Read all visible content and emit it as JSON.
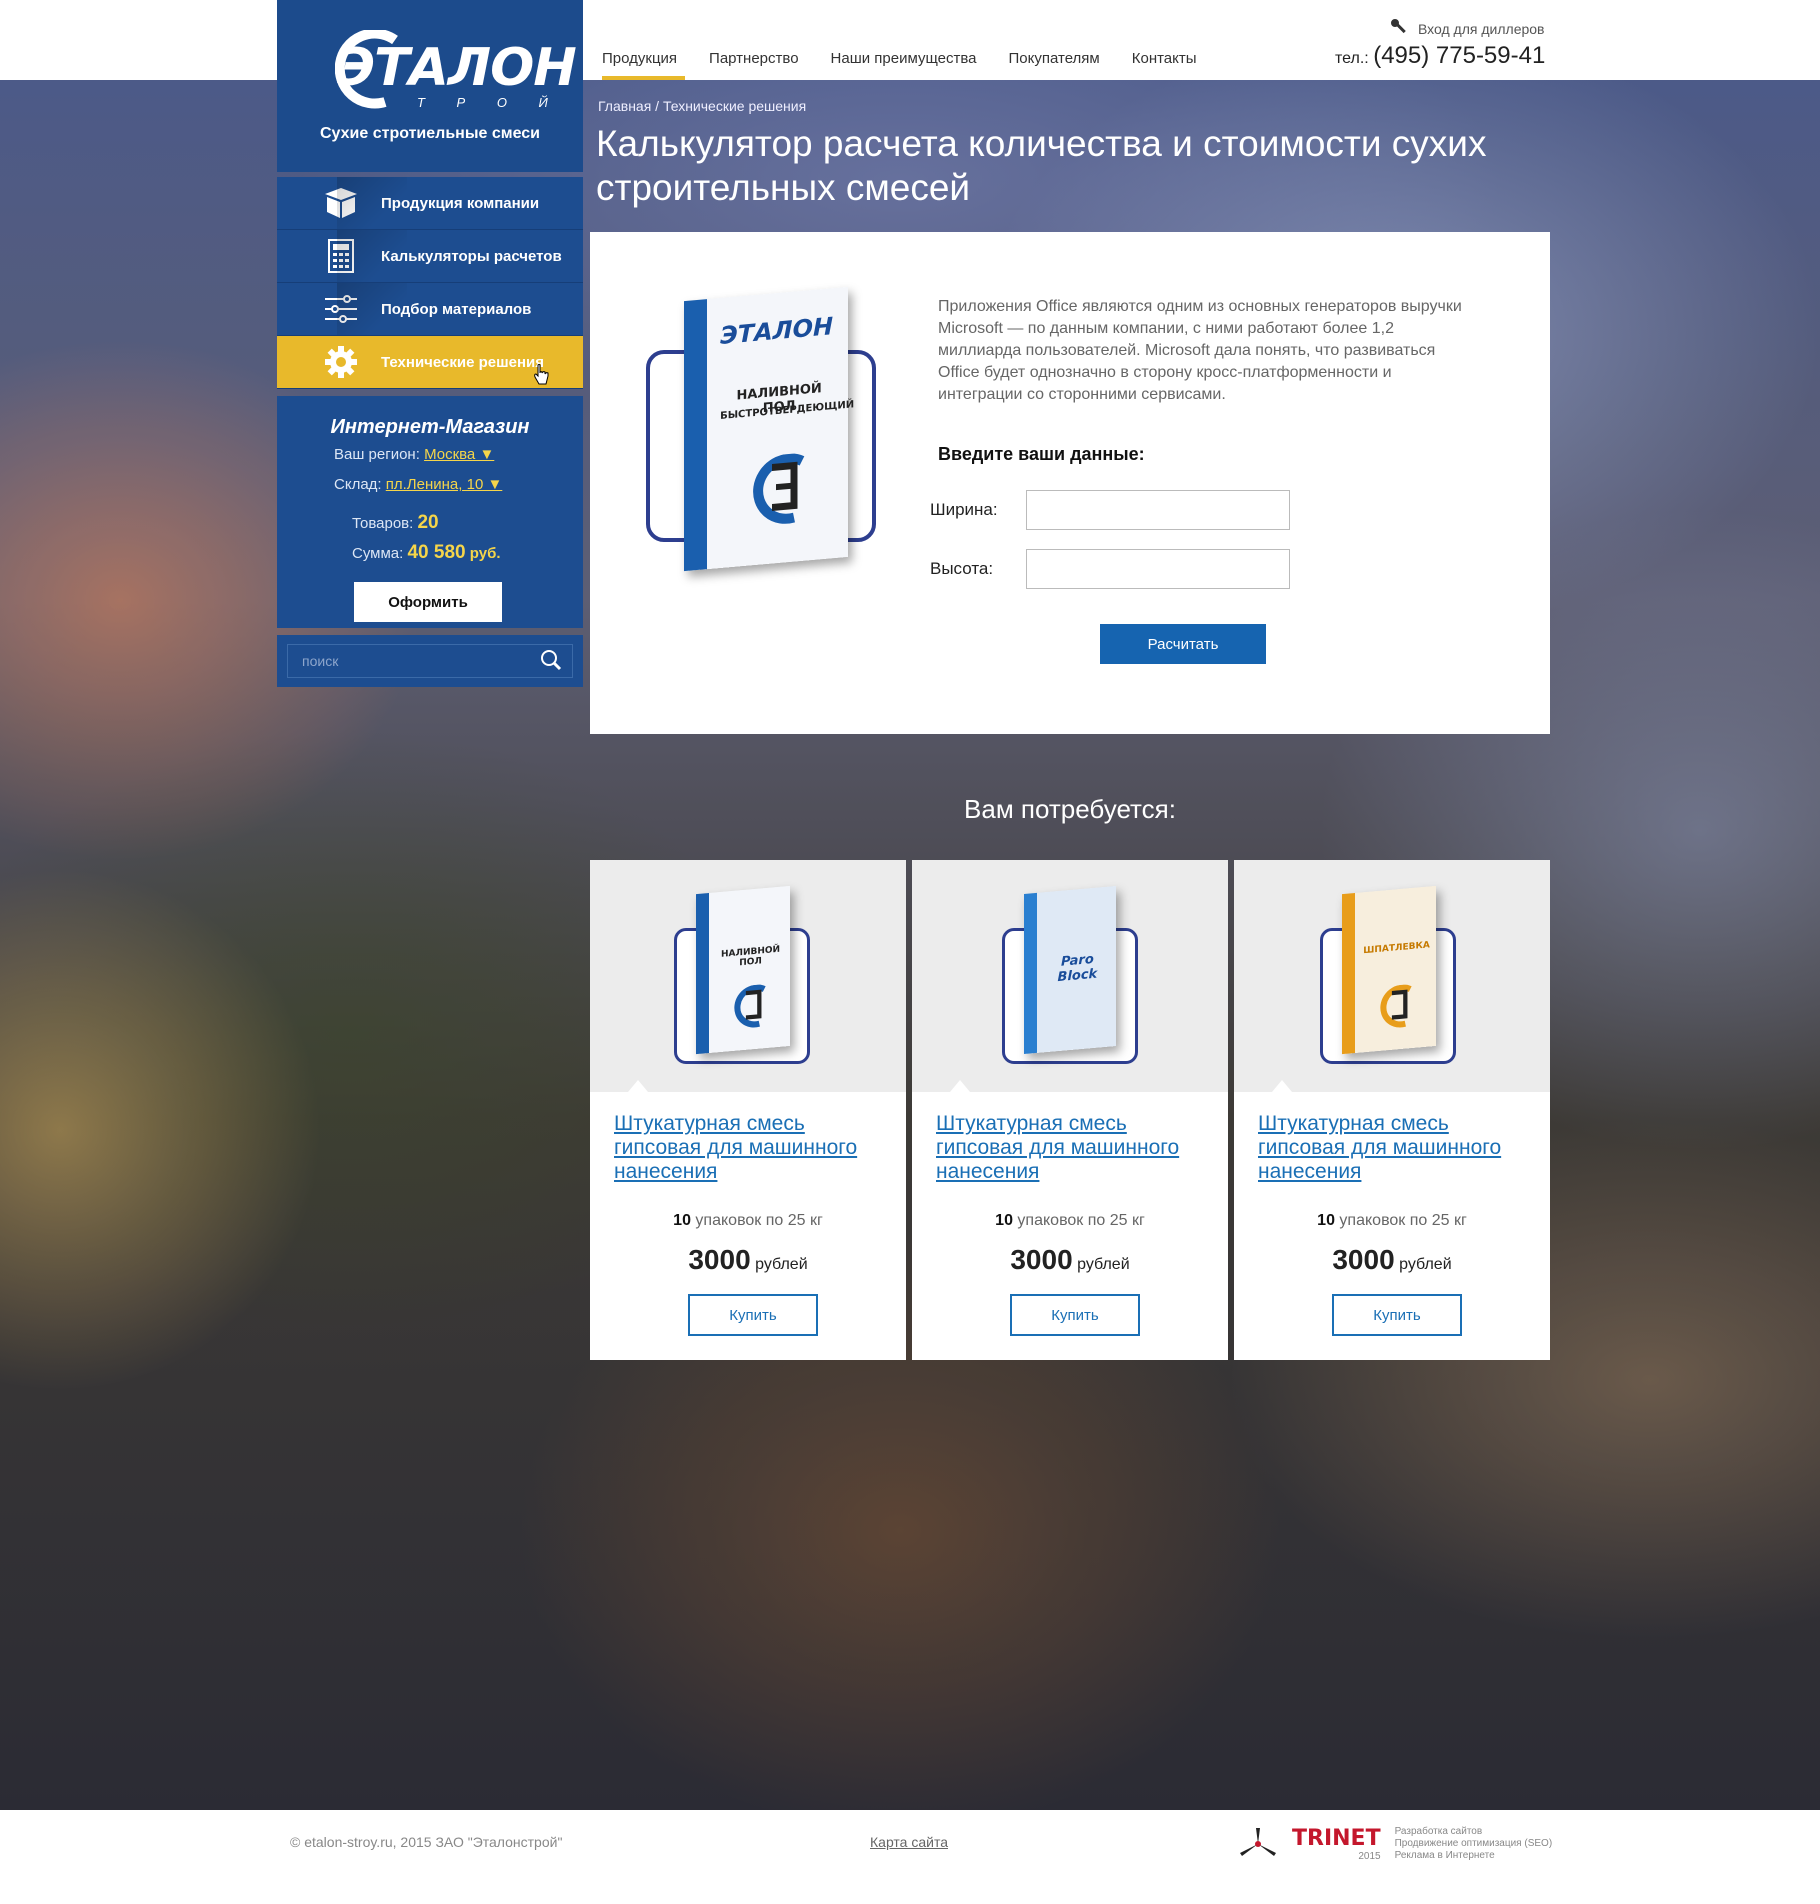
{
  "header": {
    "nav": [
      "Продукция",
      "Партнерство",
      "Наши преимущества",
      "Покупателям",
      "Контакты"
    ],
    "active_nav": 0,
    "dealer_link": "Вход для диллеров",
    "phone_prefix": "тел.:",
    "phone": "(495) 775-59-41"
  },
  "logo": {
    "main": "ЭТАЛОН",
    "sub": "Т Р О Й",
    "tagline": "Сухие стротиельные смеси"
  },
  "sidebar": {
    "items": [
      {
        "label": "Продукция компании",
        "icon": "box-icon"
      },
      {
        "label": "Калькуляторы расчетов",
        "icon": "calculator-icon"
      },
      {
        "label": "Подбор материалов",
        "icon": "sliders-icon"
      },
      {
        "label": "Технические решения",
        "icon": "gear-icon"
      }
    ],
    "active_index": 3
  },
  "shop": {
    "title": "Интернет-Магазин",
    "region_label": "Ваш регион:",
    "region_value": "Москва ▼",
    "store_label": "Склад:",
    "store_value": "пл.Ленина, 10 ▼",
    "items_label": "Товаров:",
    "items_value": "20",
    "sum_label": "Сумма:",
    "sum_value": "40 580",
    "sum_unit": "руб.",
    "order_button": "Оформить"
  },
  "search": {
    "placeholder": "поиск"
  },
  "breadcrumb": "Главная / Технические решения",
  "page_title": "Калькулятор расчета количества и стоимости сухих строительных смесей",
  "calculator": {
    "description": "Приложения Office являются одним из основных генераторов выручки Microsoft — по данным компании, с ними работают более 1,2 миллиарда пользователей. Microsoft дала понять, что развиваться Office будет однозначно в сторону кросс-платформенности и интеграции со сторонними сервисами.",
    "subtitle": "Введите ваши данные:",
    "width_label": "Ширина:",
    "height_label": "Высота:",
    "width_value": "",
    "height_value": "",
    "button": "Расчитать",
    "product_brand": "ЭТАЛОН",
    "product_name": "НАЛИВНОЙ ПОЛ",
    "product_desc": "БЫСТРОТВЕРДЕЮЩИЙ"
  },
  "need_title": "Вам потребуется:",
  "products": [
    {
      "name": "Штукатурная смесь гипсовая для машинного нанесения",
      "qty": "10",
      "qty_text": "упаковок по 25 кг",
      "price": "3000",
      "price_unit": "рублей",
      "button": "Купить",
      "bag_label": "НАЛИВНОЙ ПОЛ",
      "bag_color": "#1a5fae"
    },
    {
      "name": "Штукатурная смесь гипсовая для машинного нанесения",
      "qty": "10",
      "qty_text": "упаковок по 25 кг",
      "price": "3000",
      "price_unit": "рублей",
      "button": "Купить",
      "bag_label": "Paro Block",
      "bag_color": "#2a7fd0"
    },
    {
      "name": "Штукатурная смесь гипсовая для машинного нанесения",
      "qty": "10",
      "qty_text": "упаковок по 25 кг",
      "price": "3000",
      "price_unit": "рублей",
      "button": "Купить",
      "bag_label": "ШПАТЛЕВКА",
      "bag_color": "#e89d1a"
    }
  ],
  "footer": {
    "copyright": "© etalon-stroy.ru, 2015 ЗАО \"Эталонстрой\"",
    "sitemap": "Карта сайта",
    "dev_name": "TRINET",
    "dev_year": "2015",
    "dev_lines": [
      "Разработка сайтов",
      "Продвижение оптимизация (SEO)",
      "Реклама в Интернете"
    ]
  },
  "colors": {
    "brand_blue": "#1d4d90",
    "accent_yellow": "#e8b92b",
    "link_blue": "#1a6fb5",
    "button_blue": "#1664b0"
  }
}
